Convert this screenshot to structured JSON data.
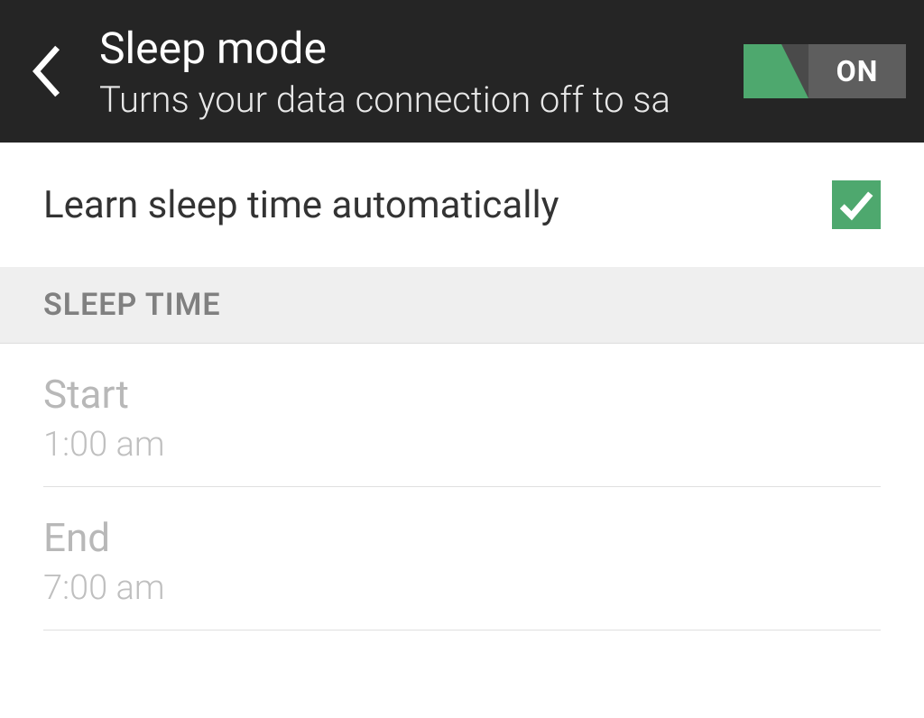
{
  "header": {
    "title": "Sleep mode",
    "subtitle": "Turns your data connection off to sa",
    "toggle_label": "ON"
  },
  "settings": {
    "learn_auto_label": "Learn sleep time automatically"
  },
  "section": {
    "title": "SLEEP TIME"
  },
  "sleep_time": {
    "start_label": "Start",
    "start_value": "1:00 am",
    "end_label": "End",
    "end_value": "7:00 am"
  }
}
